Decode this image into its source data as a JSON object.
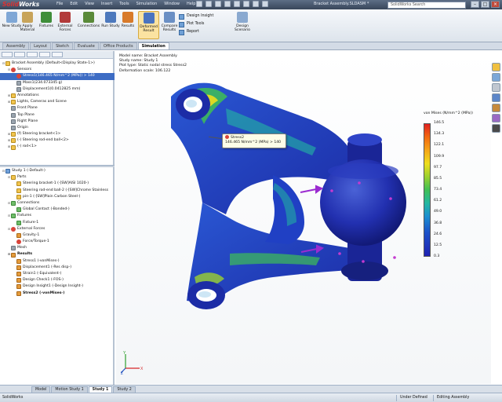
{
  "app": {
    "logo_solid": "Solid",
    "logo_works": "Works",
    "window_title": "Bracket Assembly.SLDASM *",
    "search_placeholder": "SolidWorks Search"
  },
  "menu": [
    "File",
    "Edit",
    "View",
    "Insert",
    "Tools",
    "Simulation",
    "Window",
    "Help"
  ],
  "ribbon": {
    "buttons": [
      {
        "label": "New Study",
        "color": "#7fa7d6"
      },
      {
        "label": "Apply Material",
        "color": "#c8a45a"
      },
      {
        "label": "Fixtures",
        "color": "#3f8e3a"
      },
      {
        "label": "External Forces",
        "color": "#b23a3a"
      },
      {
        "label": "Connections",
        "color": "#5a8a3a"
      },
      {
        "label": "Run Study",
        "color": "#4d79bd"
      },
      {
        "label": "Results",
        "color": "#d87a2a"
      },
      {
        "label": "Deformed Result",
        "color": "#4a74c0"
      },
      {
        "label": "Compare Results",
        "color": "#6a8fc4"
      }
    ],
    "small": [
      "Design Insight",
      "Plot Tools",
      "Report"
    ],
    "scenario": "Design Scenario"
  },
  "command_tabs": [
    "Assembly",
    "Layout",
    "Sketch",
    "Evaluate",
    "Office Products",
    "Simulation"
  ],
  "tree_top": [
    {
      "label": "Bracket Assembly (Default<Display State-1>)",
      "icon": "y",
      "indent": 0,
      "exp": "-"
    },
    {
      "label": "Sensors",
      "icon": "r",
      "indent": 1,
      "exp": "-"
    },
    {
      "label": "Stress1(146.465 N/mm^2 (MPa)) > 140",
      "icon": "r",
      "indent": 2,
      "exp": "",
      "selected": true
    },
    {
      "label": "Mass1(234.073345 g)",
      "icon": "g",
      "indent": 2,
      "exp": ""
    },
    {
      "label": "Displacement1(0.0412825 mm)",
      "icon": "g",
      "indent": 2,
      "exp": ""
    },
    {
      "label": "Annotations",
      "icon": "y",
      "indent": 1,
      "exp": "+"
    },
    {
      "label": "Lights, Cameras and Scene",
      "icon": "y",
      "indent": 1,
      "exp": "+"
    },
    {
      "label": "Front Plane",
      "icon": "g",
      "indent": 1,
      "exp": ""
    },
    {
      "label": "Top Plane",
      "icon": "g",
      "indent": 1,
      "exp": ""
    },
    {
      "label": "Right Plane",
      "icon": "g",
      "indent": 1,
      "exp": ""
    },
    {
      "label": "Origin",
      "icon": "g",
      "indent": 1,
      "exp": ""
    },
    {
      "label": "(f) Steering bracket<1>",
      "icon": "y",
      "indent": 1,
      "exp": "+"
    },
    {
      "label": "(-) Steering rod-end ball<2>",
      "icon": "y",
      "indent": 1,
      "exp": "+"
    },
    {
      "label": "(-) rod<1>",
      "icon": "y",
      "indent": 1,
      "exp": "+"
    }
  ],
  "tree_bottom": [
    {
      "label": "Study 1 (-Default-)",
      "icon": "b",
      "indent": 0,
      "exp": "-"
    },
    {
      "label": "Parts",
      "icon": "y",
      "indent": 1,
      "exp": "-"
    },
    {
      "label": "Steering bracket-1 (-[SW]AISI 1020-)",
      "icon": "y",
      "indent": 2,
      "exp": ""
    },
    {
      "label": "Steering rod-end ball-2 (-[SW]Chrome Stainless",
      "icon": "y",
      "indent": 2,
      "exp": ""
    },
    {
      "label": "pin-1 (-[SW]Plain Carbon Steel-)",
      "icon": "y",
      "indent": 2,
      "exp": ""
    },
    {
      "label": "Connections",
      "icon": "p",
      "indent": 1,
      "exp": "-"
    },
    {
      "label": "Global Contact (-Bonded-)",
      "icon": "p",
      "indent": 2,
      "exp": ""
    },
    {
      "label": "Fixtures",
      "icon": "p",
      "indent": 1,
      "exp": "-"
    },
    {
      "label": "Fixture-1",
      "icon": "p",
      "indent": 2,
      "exp": ""
    },
    {
      "label": "External Forces",
      "icon": "r",
      "indent": 1,
      "exp": "-"
    },
    {
      "label": "Gravity-1",
      "icon": "o",
      "indent": 2,
      "exp": ""
    },
    {
      "label": "Force/Torque-1",
      "icon": "r",
      "indent": 2,
      "exp": ""
    },
    {
      "label": "Mesh",
      "icon": "g",
      "indent": 1,
      "exp": ""
    },
    {
      "label": "Results",
      "icon": "o",
      "indent": 1,
      "exp": "-",
      "bold": true
    },
    {
      "label": "Stress1 (-vonMises-)",
      "icon": "o",
      "indent": 2,
      "exp": ""
    },
    {
      "label": "Displacement1 (-Res disp-)",
      "icon": "o",
      "indent": 2,
      "exp": ""
    },
    {
      "label": "Strain1 (-Equivalent-)",
      "icon": "o",
      "indent": 2,
      "exp": ""
    },
    {
      "label": "Design Check1 (-FOS-)",
      "icon": "o",
      "indent": 2,
      "exp": ""
    },
    {
      "label": "Design Insight1 (-Design Insight-)",
      "icon": "o",
      "indent": 2,
      "exp": ""
    },
    {
      "label": "Stress2 (-vonMises-)",
      "icon": "o",
      "indent": 2,
      "exp": "",
      "bold": true
    }
  ],
  "plot_info": [
    "Model name: Bracket Assembly",
    "Study name: Study 1",
    "Plot type: Static nodal stress Stress2",
    "Deformation scale: 106.122"
  ],
  "legend": {
    "title": "von Mises (N/mm^2 (MPa))",
    "ticks": [
      "146.5",
      "134.3",
      "122.1",
      "109.9",
      "97.7",
      "85.5",
      "73.4",
      "61.2",
      "49.0",
      "36.8",
      "24.6",
      "12.5",
      "0.3"
    ]
  },
  "tooltip": {
    "title": "Stress2",
    "value": "146.465 N/mm^2 (MPa) > 140"
  },
  "bottom_tabs": [
    "Model",
    "Motion Study 1",
    "Study 1",
    "Study 2"
  ],
  "status": {
    "app": "SolidWorks",
    "defined": "Under Defined",
    "mode": "Editing Assembly"
  },
  "triad": {
    "x": "X",
    "y": "Y",
    "z": "Z"
  }
}
